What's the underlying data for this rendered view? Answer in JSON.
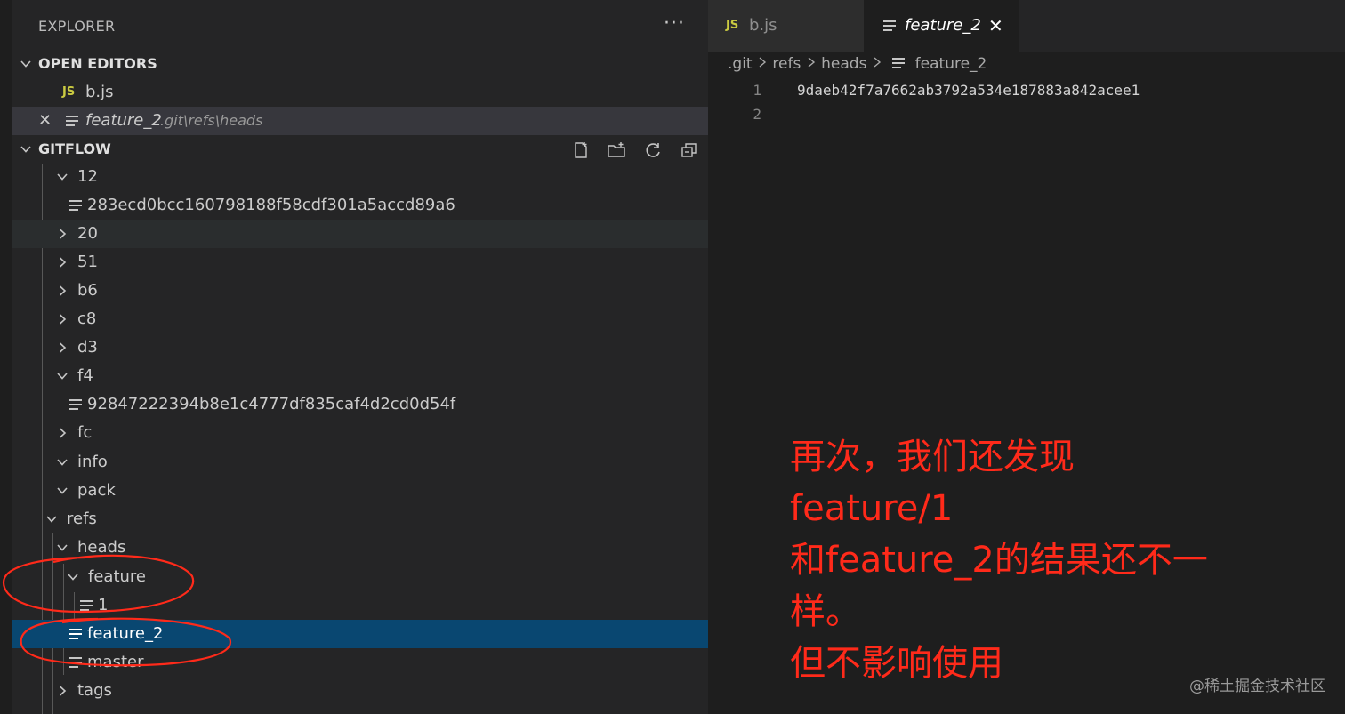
{
  "sidebar": {
    "title": "EXPLORER",
    "more": "···",
    "open_editors": {
      "label": "OPEN EDITORS",
      "items": [
        {
          "badge": "JS",
          "name": "b.js"
        },
        {
          "name": "feature_2",
          "path": ".git\\refs\\heads"
        }
      ]
    },
    "gitflow": {
      "label": "GITFLOW",
      "tree": [
        {
          "label": "12"
        },
        {
          "label": "283ecd0bcc160798188f58cdf301a5accd89a6"
        },
        {
          "label": "20"
        },
        {
          "label": "51"
        },
        {
          "label": "b6"
        },
        {
          "label": "c8"
        },
        {
          "label": "d3"
        },
        {
          "label": "f4"
        },
        {
          "label": "92847222394b8e1c4777df835caf4d2cd0d54f"
        },
        {
          "label": "fc"
        },
        {
          "label": "info"
        },
        {
          "label": "pack"
        },
        {
          "label": "refs"
        },
        {
          "label": "heads"
        },
        {
          "label": "feature"
        },
        {
          "label": "1"
        },
        {
          "label": "feature_2"
        },
        {
          "label": "master"
        },
        {
          "label": "tags"
        }
      ]
    }
  },
  "editor": {
    "tabs": [
      {
        "badge": "JS",
        "label": "b.js"
      },
      {
        "label": "feature_2",
        "close": "✕"
      }
    ],
    "breadcrumb": [
      ".git",
      "refs",
      "heads",
      "feature_2"
    ],
    "lines": [
      {
        "num": "1",
        "text": "9daeb42f7a7662ab3792a534e187883a842acee1"
      },
      {
        "num": "2",
        "text": ""
      }
    ]
  },
  "annotation": {
    "lines": [
      "再次，我们还发现",
      "feature/1",
      "和feature_2的结果还不一",
      "样。",
      "但不影响使用"
    ],
    "color": "#ff2a1a"
  },
  "watermark": "@稀土掘金技术社区",
  "colors": {
    "sidebar_bg": "#252526",
    "editor_bg": "#1e1e1e",
    "selection": "#094771",
    "js_badge": "#cbcb41"
  }
}
